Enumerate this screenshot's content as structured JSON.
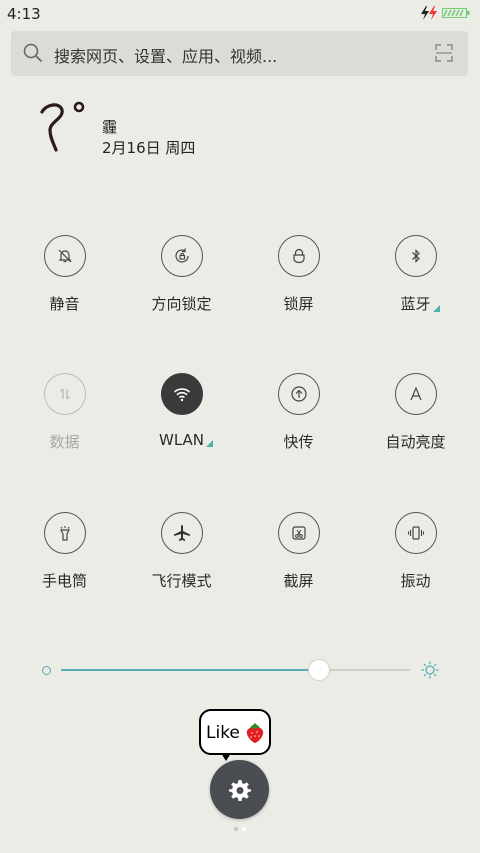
{
  "status_bar": {
    "time": "4:13",
    "icons": [
      "charging-bolt-icon",
      "battery-icon"
    ]
  },
  "search": {
    "placeholder": "搜索网页、设置、应用、视频..."
  },
  "weather": {
    "temperature": "?",
    "unit": "°",
    "condition": "霾",
    "date": "2月16日 周四"
  },
  "quick_settings": [
    {
      "label": "静音",
      "icon": "bell-off-icon",
      "state": "off"
    },
    {
      "label": "方向锁定",
      "icon": "rotation-lock-icon",
      "state": "off"
    },
    {
      "label": "锁屏",
      "icon": "lock-icon",
      "state": "off"
    },
    {
      "label": "蓝牙",
      "icon": "bluetooth-icon",
      "state": "off",
      "has_menu": true
    },
    {
      "label": "数据",
      "icon": "mobile-data-icon",
      "state": "disabled"
    },
    {
      "label": "WLAN",
      "icon": "wifi-icon",
      "state": "on",
      "has_menu": true
    },
    {
      "label": "快传",
      "icon": "quick-share-icon",
      "state": "off"
    },
    {
      "label": "自动亮度",
      "icon": "auto-brightness-icon",
      "state": "off"
    },
    {
      "label": "手电筒",
      "icon": "flashlight-icon",
      "state": "off"
    },
    {
      "label": "飞行模式",
      "icon": "airplane-icon",
      "state": "off"
    },
    {
      "label": "截屏",
      "icon": "screenshot-icon",
      "state": "off"
    },
    {
      "label": "振动",
      "icon": "vibrate-icon",
      "state": "off"
    }
  ],
  "brightness": {
    "level": 0.74
  },
  "like_sticker": {
    "text": "Like"
  },
  "page_indicator": {
    "pages": 2,
    "current": 2
  },
  "colors": {
    "accent": "#57aeb0",
    "background": "#ecece7"
  }
}
